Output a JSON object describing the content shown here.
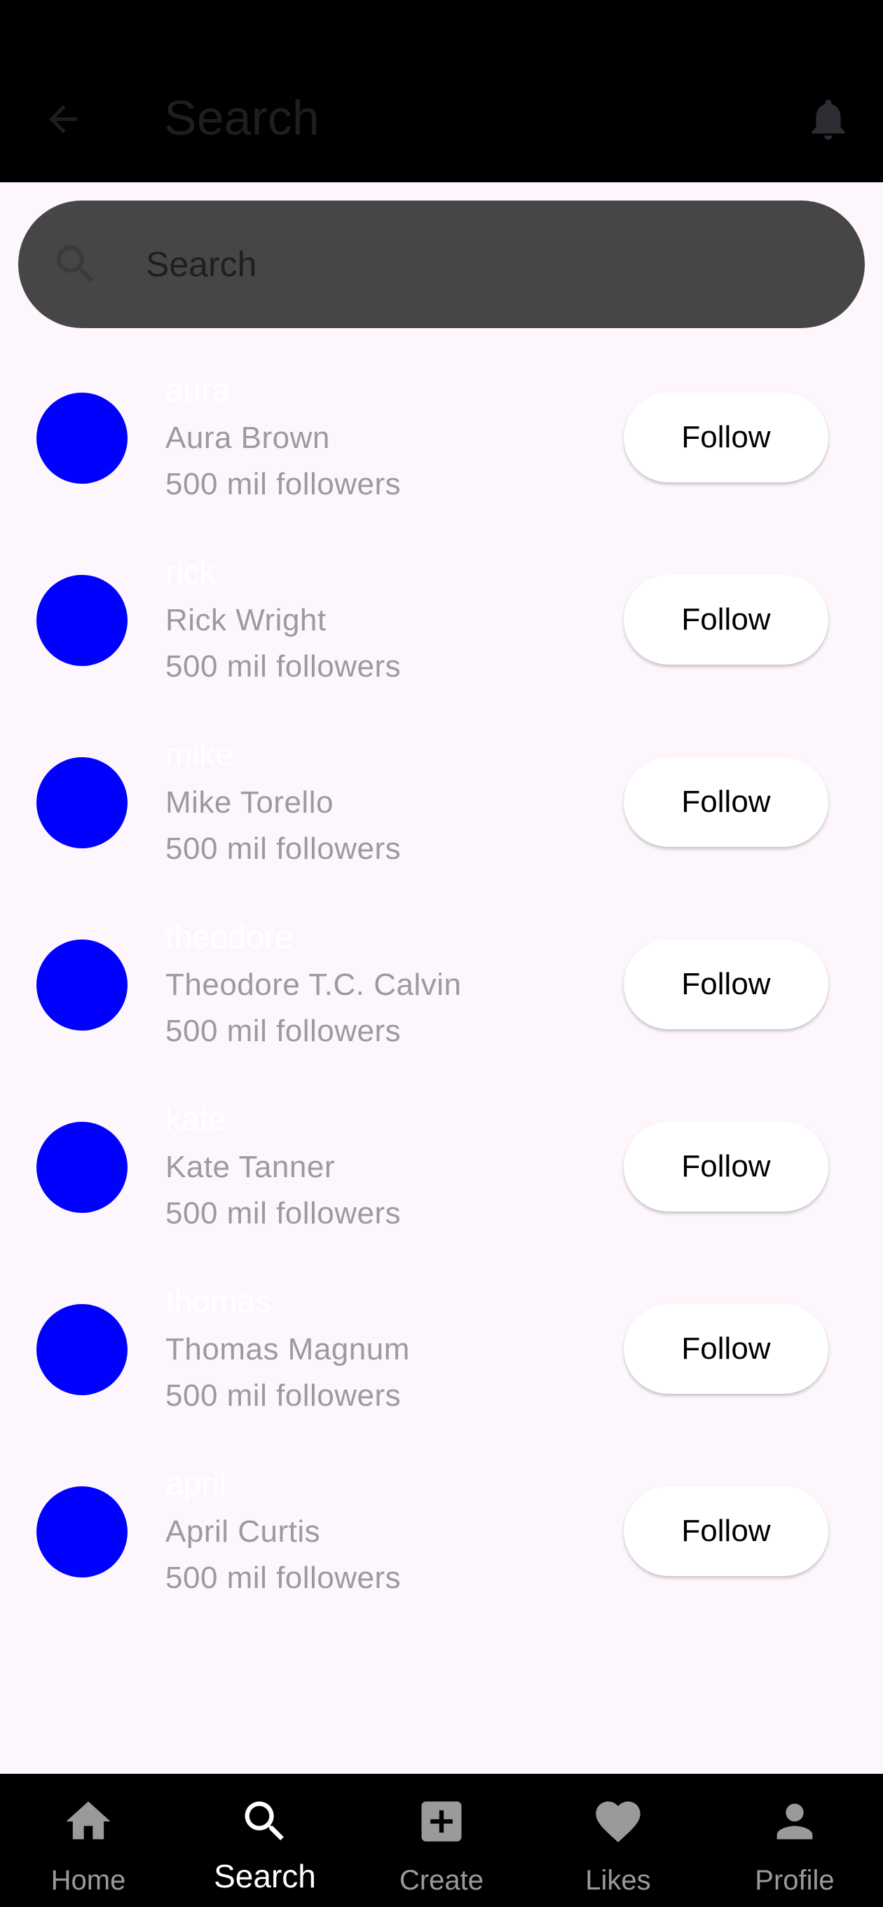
{
  "app_bar": {
    "title": "Search",
    "back_icon": "arrow-left-icon",
    "notifications_icon": "bell-icon"
  },
  "search": {
    "placeholder": "Search",
    "value": "",
    "icon": "search-icon"
  },
  "users": [
    {
      "username": "aura",
      "name": "Aura Brown",
      "followers": "500 mil followers",
      "follow_label": "Follow"
    },
    {
      "username": "rick",
      "name": "Rick Wright",
      "followers": "500 mil followers",
      "follow_label": "Follow"
    },
    {
      "username": "mike",
      "name": "Mike Torello",
      "followers": "500 mil followers",
      "follow_label": "Follow"
    },
    {
      "username": "theodore",
      "name": "Theodore T.C. Calvin",
      "followers": "500 mil followers",
      "follow_label": "Follow"
    },
    {
      "username": "kate",
      "name": "Kate Tanner",
      "followers": "500 mil followers",
      "follow_label": "Follow"
    },
    {
      "username": "thomas",
      "name": "Thomas Magnum",
      "followers": "500 mil followers",
      "follow_label": "Follow"
    },
    {
      "username": "april",
      "name": "April Curtis",
      "followers": "500 mil followers",
      "follow_label": "Follow"
    }
  ],
  "bottom_nav": {
    "items": [
      {
        "label": "Home",
        "icon": "home-icon",
        "active": false
      },
      {
        "label": "Search",
        "icon": "search-icon",
        "active": true
      },
      {
        "label": "Create",
        "icon": "add-box-icon",
        "active": false
      },
      {
        "label": "Likes",
        "icon": "heart-icon",
        "active": false
      },
      {
        "label": "Profile",
        "icon": "person-icon",
        "active": false
      }
    ]
  },
  "colors": {
    "app_bar_background": "#000000",
    "page_background": "#fdf7fd",
    "search_bar_background": "#464646",
    "avatar": "#0000ff",
    "secondary_text": "#9b9b9b",
    "follow_button_background": "#ffffff",
    "nav_active": "#ffffff",
    "nav_inactive": "#9a9a9a"
  }
}
